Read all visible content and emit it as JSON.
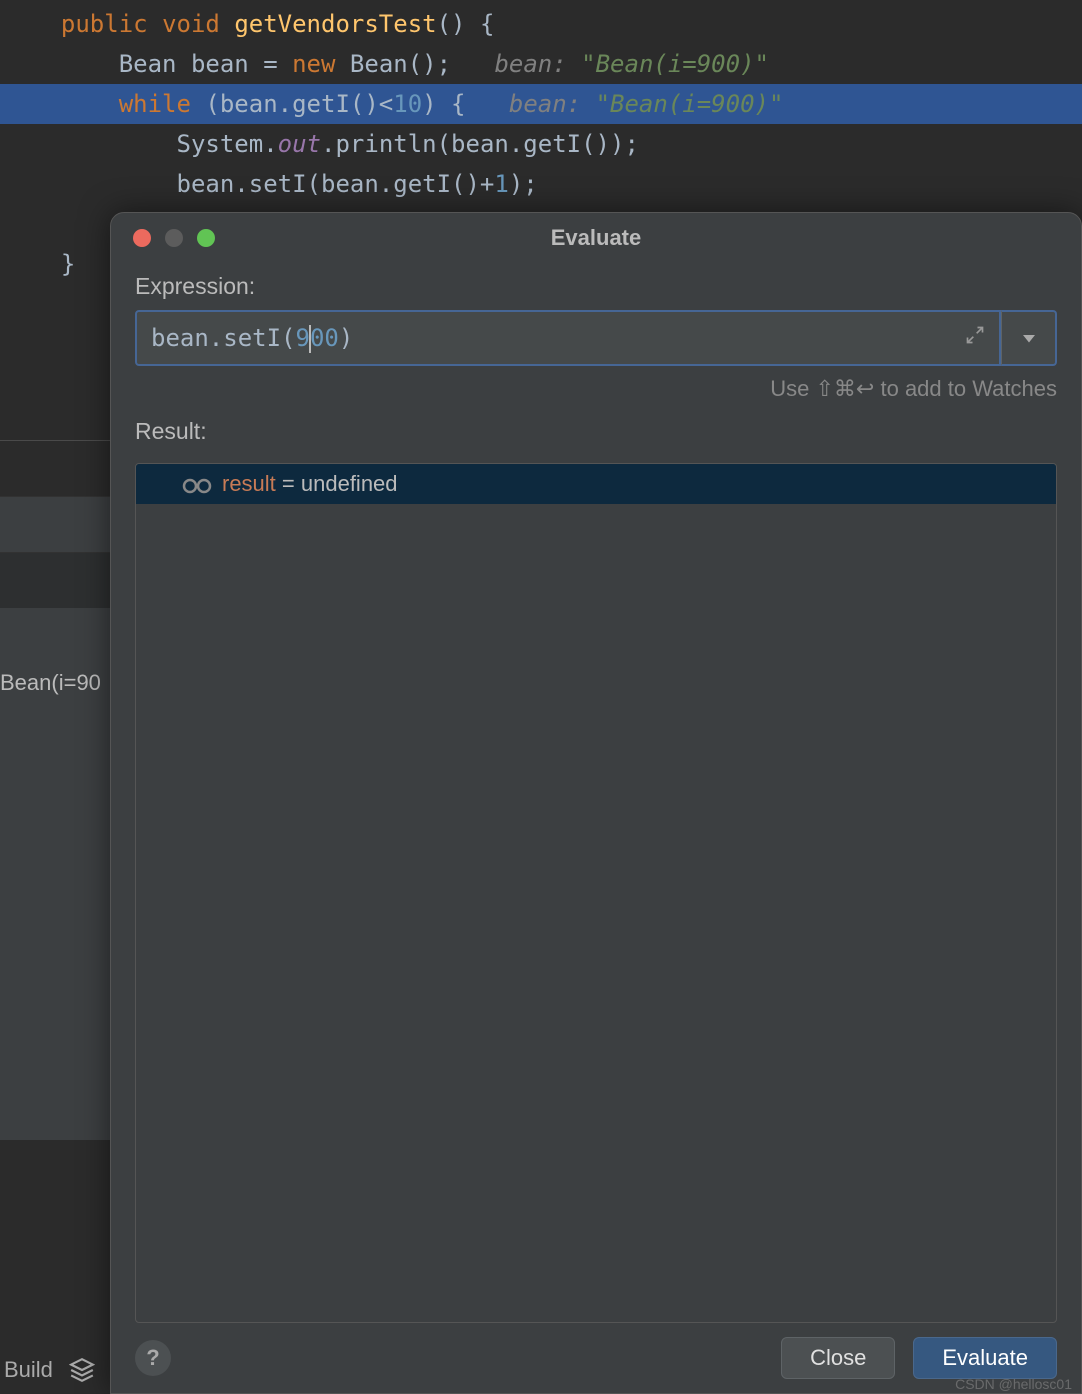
{
  "code": {
    "line1": {
      "kw1": "public",
      "kw2": "void",
      "method": "getVendorsTest",
      "rest": "() {"
    },
    "line2": {
      "type": "Bean",
      "var": "bean",
      "eq": " = ",
      "kw": "new",
      "ctor": "Bean();",
      "hint_lbl": "bean: ",
      "hint_val": "\"Bean(i=900)\""
    },
    "line3": {
      "kw": "while",
      "cond_open": " (bean.getI()<",
      "num": "10",
      "cond_close": ") {",
      "hint_lbl": "bean: ",
      "hint_val": "\"Bean(i=900)\""
    },
    "line4": {
      "pre": "System.",
      "field": "out",
      "rest": ".println(bean.getI());"
    },
    "line5": {
      "pre": "bean.setI(bean.getI()+",
      "num": "1",
      "post": ");"
    },
    "line6": "}",
    "line7": "}"
  },
  "sidebar": {
    "text": "Bean(i=90"
  },
  "dialog": {
    "title": "Evaluate",
    "expression_label": "Expression:",
    "expression": {
      "pre": "bean.setI(",
      "num_a": "9",
      "num_b": "00",
      "post": ")"
    },
    "hint": "Use ⇧⌘↩ to add to Watches",
    "result_label": "Result:",
    "result": {
      "name": "result",
      "eq": " = ",
      "value": "undefined"
    },
    "buttons": {
      "help": "?",
      "close": "Close",
      "evaluate": "Evaluate"
    }
  },
  "bottom": {
    "build": "Build"
  },
  "watermark": "CSDN @hellosc01"
}
